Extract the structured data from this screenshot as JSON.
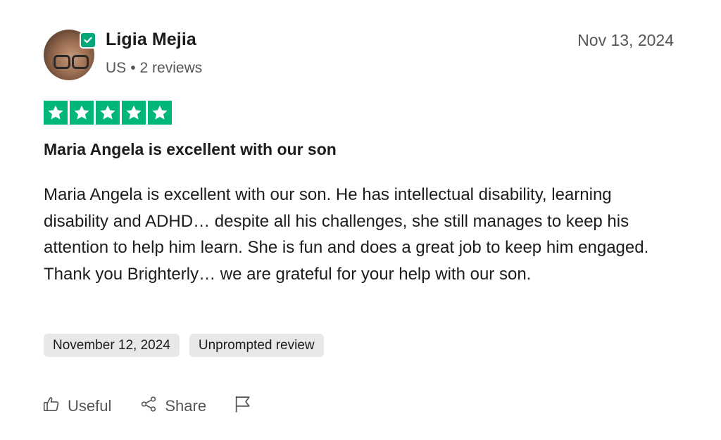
{
  "review": {
    "author": {
      "name": "Ligia Mejia",
      "country": "US",
      "separator": "•",
      "reviews_count": "2 reviews",
      "verified": true
    },
    "posted_date": "Nov 13, 2024",
    "rating": {
      "stars": 5,
      "max": 5,
      "color": "#00b67a"
    },
    "title": "Maria Angela is excellent with our son",
    "text": "Maria Angela is excellent with our son. He has intellectual disability, learning disability and ADHD… despite all his challenges, she still manages to keep his attention to help him learn. She is fun and does a great job to keep him engaged. Thank you Brighterly… we are grateful for your help with our son.",
    "tags": [
      "November 12, 2024",
      "Unprompted review"
    ]
  },
  "actions": {
    "useful_label": "Useful",
    "share_label": "Share",
    "icons": {
      "useful": "thumbs-up-icon",
      "share": "share-icon",
      "report": "flag-icon"
    }
  }
}
